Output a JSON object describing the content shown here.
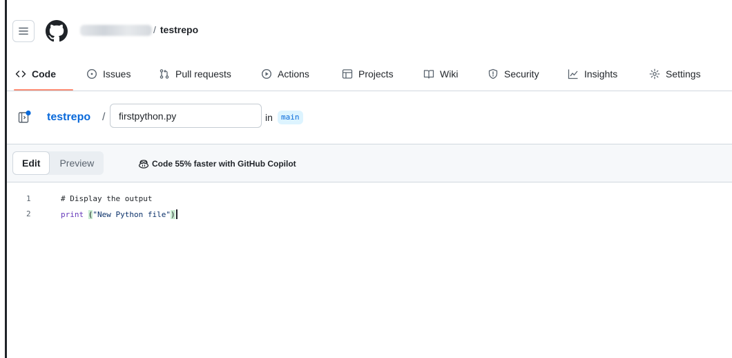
{
  "header": {
    "repo_name": "testrepo",
    "slash": "/"
  },
  "nav": {
    "tabs": [
      {
        "label": "Code",
        "icon": "code-icon",
        "active": true
      },
      {
        "label": "Issues",
        "icon": "issue-opened-icon"
      },
      {
        "label": "Pull requests",
        "icon": "git-pull-request-icon"
      },
      {
        "label": "Actions",
        "icon": "play-icon"
      },
      {
        "label": "Projects",
        "icon": "table-icon"
      },
      {
        "label": "Wiki",
        "icon": "book-icon"
      },
      {
        "label": "Security",
        "icon": "shield-icon"
      },
      {
        "label": "Insights",
        "icon": "graph-icon"
      },
      {
        "label": "Settings",
        "icon": "gear-icon"
      }
    ]
  },
  "breadcrumb": {
    "repo": "testrepo",
    "slash": "/",
    "filename": "firstpython.py",
    "in_label": "in",
    "branch": "main"
  },
  "editor": {
    "edit_label": "Edit",
    "preview_label": "Preview",
    "copilot_tip": "Code 55% faster with GitHub Copilot",
    "lines": [
      {
        "number": "1",
        "text": "# Display the output"
      },
      {
        "number": "2",
        "keyword": "print",
        "space": " ",
        "open_paren": "(",
        "string": "\"New Python file\"",
        "close_paren": ")"
      }
    ]
  },
  "colors": {
    "accent_blue": "#0969da",
    "tab_underline": "#fd8c73",
    "branch_bg": "#ddf4ff"
  }
}
